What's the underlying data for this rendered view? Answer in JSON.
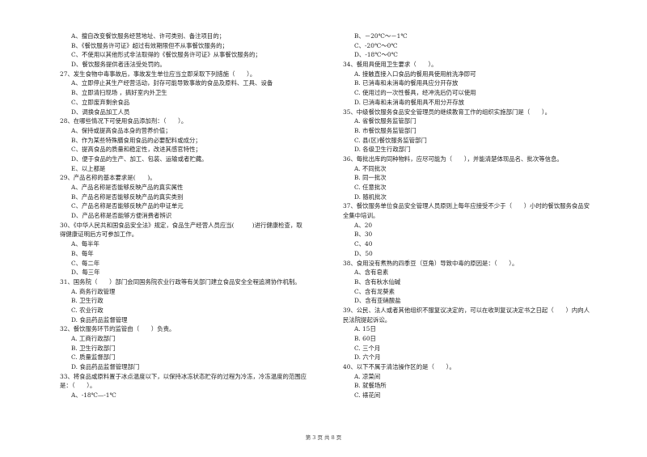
{
  "left_column": {
    "lines": [
      {
        "type": "opt",
        "text": "A、擅自改变餐饮服务经营地址、许可类别、备注项目的；"
      },
      {
        "type": "opt",
        "text": "B、《餐饮服务许可证》超过有效期限但不从事餐饮服务的；"
      },
      {
        "type": "opt",
        "text": "C、不使用以其他形式非法取得的《餐饮服务许可证》从事餐饮服务的；"
      },
      {
        "type": "opt",
        "text": "D、餐饮服务提供者违法受处罚的。"
      },
      {
        "type": "q",
        "text": "27、发生食物中毒事故后，事故发生单位应当立即采取下列措施（　　）。"
      },
      {
        "type": "opt",
        "text": "A、立即停止其生产经营活动，封存可能导致事故的食品及原料、工具、设备"
      },
      {
        "type": "opt",
        "text": "B、立即清扫现场 ，搞好室内外卫生"
      },
      {
        "type": "opt",
        "text": "C、立即废弃剩余食品"
      },
      {
        "type": "opt",
        "text": "D、调换食品加工人员"
      },
      {
        "type": "q",
        "text": "28、在哪些情况下可使用食品添加剂：（　　）。"
      },
      {
        "type": "opt",
        "text": "A、保持或提高食品本身的营养价值；"
      },
      {
        "type": "opt",
        "text": "B、作为某些特殊膳食用食品的必要配料或成分；"
      },
      {
        "type": "opt",
        "text": "C、提高食品的质量和稳定性，改进其感官特性；"
      },
      {
        "type": "opt",
        "text": "D、便于食品的生产、加工、包装、运输或者贮藏。"
      },
      {
        "type": "opt",
        "text": "E、以上都是"
      },
      {
        "type": "q",
        "text": "29、产品名称的基本要求是(　　)。"
      },
      {
        "type": "opt",
        "text": "A、产品名称是否能够反映产品的真实属性"
      },
      {
        "type": "opt",
        "text": "B、产品名称是否能够反映产品的真实类别"
      },
      {
        "type": "opt",
        "text": "C、产品名称是否能够反映产品的申证单元"
      },
      {
        "type": "opt",
        "text": "D、产品名称是否能够方便消费者辨识"
      },
      {
        "type": "q",
        "text": "30、《中华人民共和国食品安全法》规定，食品生产经营人员应当(　　　)进行健康检查，取"
      },
      {
        "type": "qc",
        "text": "得健康证明后方可参加工作。"
      },
      {
        "type": "opt",
        "text": "A、每半年"
      },
      {
        "type": "opt",
        "text": "B、每年"
      },
      {
        "type": "opt",
        "text": "C、每二年"
      },
      {
        "type": "opt",
        "text": "D、每三年"
      },
      {
        "type": "q",
        "text": "31、国务院（　　）部门会同国务院农业行政等有关部门建立食品安全全程追溯协作机制。"
      },
      {
        "type": "opt",
        "text": "A. 商务行政管理"
      },
      {
        "type": "opt",
        "text": "B. 卫生行政"
      },
      {
        "type": "opt",
        "text": "C. 农业行政"
      },
      {
        "type": "opt",
        "text": "D. 食品药品监督管理"
      },
      {
        "type": "q",
        "text": "32、餐饮服务环节的监管由（　　）负责。"
      },
      {
        "type": "opt",
        "text": "A. 工商行政部门"
      },
      {
        "type": "opt",
        "text": "B. 卫生行政部门"
      },
      {
        "type": "opt",
        "text": "C. 质量监督部门"
      },
      {
        "type": "opt",
        "text": "D. 食品药品监督管理部门"
      },
      {
        "type": "q",
        "text": "33、将食品或原料置于冰点温度以下，以保持冰冻状态贮存的过程为冷冻，冷冻温度的范围应"
      },
      {
        "type": "qc",
        "text": "是：（　　）。"
      },
      {
        "type": "opt",
        "text": "A、-18℃—-1℃"
      }
    ]
  },
  "right_column": {
    "lines": [
      {
        "type": "opt",
        "text": "B、－20℃～－1℃"
      },
      {
        "type": "opt",
        "text": "C、-20℃～0℃"
      },
      {
        "type": "opt",
        "text": "D、-18℃～0℃"
      },
      {
        "type": "q",
        "text": "34、餐用具使用卫生要求（　　）。"
      },
      {
        "type": "opt",
        "text": "A. 接触直接入口食品的餐用具使用前洗净即可"
      },
      {
        "type": "opt",
        "text": "B. 已消毒和未消毒的餐用具应分开存放"
      },
      {
        "type": "opt",
        "text": "C. 使用过的一次性餐具，经冲洗后仍可以使用"
      },
      {
        "type": "opt",
        "text": "D. 已消毒和未消毒的餐用具不用分开存放"
      },
      {
        "type": "q",
        "text": "35、中级餐饮服务食品安全管理员的继续教育工作的组织实施部门是（　　）。"
      },
      {
        "type": "opt",
        "text": "A. 省餐饮服务监管部门"
      },
      {
        "type": "opt",
        "text": "B. 市餐饮服务监管部门"
      },
      {
        "type": "opt",
        "text": "C. 县(区)餐饮服务监管部门"
      },
      {
        "type": "opt",
        "text": "D. 各级卫生行政部门"
      },
      {
        "type": "q",
        "text": "36、每批出库的同种物料，应尽可能为（　　），并能清楚体现品名、批次等信息。"
      },
      {
        "type": "opt",
        "text": "A. 不同批次"
      },
      {
        "type": "opt",
        "text": "B. 同一批次"
      },
      {
        "type": "opt",
        "text": "C. 任意批次"
      },
      {
        "type": "opt",
        "text": "D. 随机批次"
      },
      {
        "type": "q",
        "text": "37、餐饮服务单位食品安全管理人员原则上每年应接受不少于（　　）小时的餐饮服务食品安"
      },
      {
        "type": "qc",
        "text": "全集中培训。"
      },
      {
        "type": "opt",
        "text": "A、20"
      },
      {
        "type": "opt",
        "text": "B、30"
      },
      {
        "type": "opt",
        "text": "C、40"
      },
      {
        "type": "opt",
        "text": "D、50"
      },
      {
        "type": "q",
        "text": "38、食用没有煮熟的四季豆（豆角）导致中毒的原因是：（　　）。"
      },
      {
        "type": "opt",
        "text": "A、含有皂素"
      },
      {
        "type": "opt",
        "text": "B、含有秋水仙碱"
      },
      {
        "type": "opt",
        "text": "C、含有龙葵素"
      },
      {
        "type": "opt",
        "text": "D、含有亚硝酸盐"
      },
      {
        "type": "q",
        "text": "39、公民、法人或者其他组织不服复议决定的，可以在收到复议决定书之日起（　　）内向人"
      },
      {
        "type": "qc",
        "text": "民法院提起诉讼。"
      },
      {
        "type": "opt",
        "text": "A. 15日"
      },
      {
        "type": "opt",
        "text": "B. 60日"
      },
      {
        "type": "opt",
        "text": "C. 三个月"
      },
      {
        "type": "opt",
        "text": "D. 六个月"
      },
      {
        "type": "q",
        "text": "40、以下不属于清洁操作区的是（　　）。"
      },
      {
        "type": "opt",
        "text": "A. 凉菜间"
      },
      {
        "type": "opt",
        "text": "B. 就餐场所"
      },
      {
        "type": "opt",
        "text": "C. 裱花间"
      }
    ]
  },
  "footer": {
    "page_label": "第 3 页 共 8 页"
  }
}
